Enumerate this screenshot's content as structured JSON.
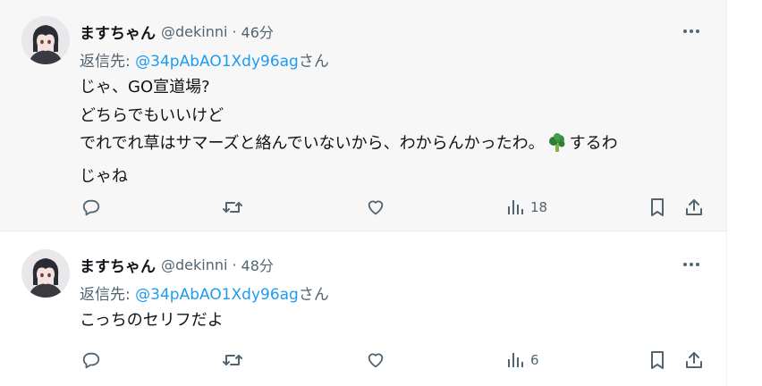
{
  "tweets": [
    {
      "display_name": "ますちゃん",
      "handle": "@dekinni",
      "separator": "·",
      "time": "46分",
      "reply_prefix": "返信先: ",
      "reply_mention": "@34pAbAO1Xdy96ag",
      "reply_suffix": "さん",
      "lines": [
        "じゃ、GO宣道場?",
        "どちらでもいいけど",
        "でれでれ草はサマーズと絡んでいないから、わからんかったわ。",
        "じゃね"
      ],
      "line3_after_emoji": "するわ",
      "views": "18"
    },
    {
      "display_name": "ますちゃん",
      "handle": "@dekinni",
      "separator": "·",
      "time": "48分",
      "reply_prefix": "返信先: ",
      "reply_mention": "@34pAbAO1Xdy96ag",
      "reply_suffix": "さん",
      "lines": [
        "こっちのセリフだよ"
      ],
      "views": "6"
    }
  ],
  "icons": {
    "more": "more-dots-icon",
    "reply": "reply-bubble-icon",
    "retweet": "retweet-icon",
    "like": "heart-icon",
    "views": "views-chart-icon",
    "bookmark": "bookmark-icon",
    "share": "share-icon",
    "emoji": "broccoli-emoji"
  },
  "colors": {
    "text": "#0f1419",
    "secondary": "#536471",
    "link": "#1d9bf0",
    "highlight_bg": "#f7f7f7"
  }
}
